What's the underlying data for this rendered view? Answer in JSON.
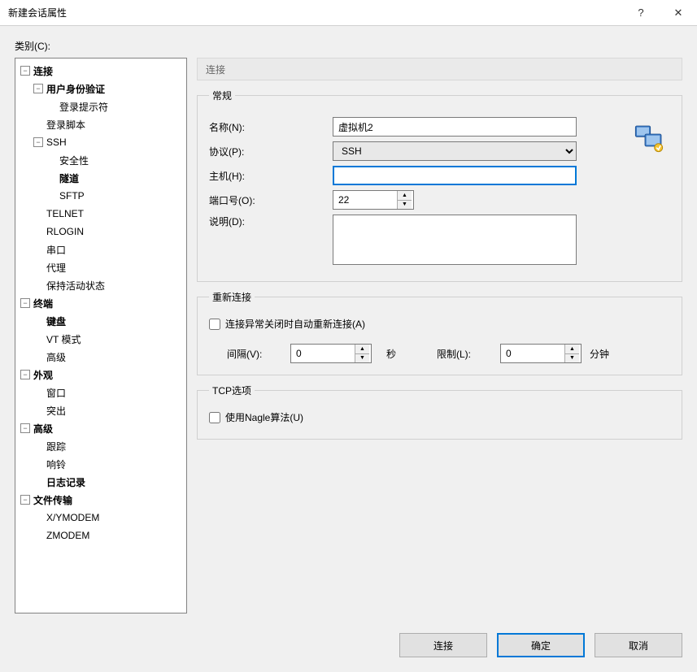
{
  "window": {
    "title": "新建会话属性",
    "help": "?",
    "close": "✕"
  },
  "category_label": "类别(C):",
  "tree": {
    "connection": "连接",
    "user_auth": "用户身份验证",
    "login_prompt": "登录提示符",
    "login_script": "登录脚本",
    "ssh": "SSH",
    "security": "安全性",
    "tunnel": "隧道",
    "sftp": "SFTP",
    "telnet": "TELNET",
    "rlogin": "RLOGIN",
    "serial": "串口",
    "proxy": "代理",
    "keep_alive": "保持活动状态",
    "terminal": "终端",
    "keyboard": "键盘",
    "vt_mode": "VT 模式",
    "advanced_term": "高级",
    "appearance": "外观",
    "window": "窗口",
    "highlight": "突出",
    "advanced": "高级",
    "trace": "跟踪",
    "bell": "响铃",
    "logging": "日志记录",
    "file_transfer": "文件传输",
    "xymodem": "X/YMODEM",
    "zmodem": "ZMODEM"
  },
  "header": "连接",
  "general": {
    "legend": "常规",
    "name_label": "名称(N):",
    "name_value": "虚拟机2",
    "protocol_label": "协议(P):",
    "protocol_value": "SSH",
    "host_label": "主机(H):",
    "host_value": "",
    "port_label": "端口号(O):",
    "port_value": "22",
    "desc_label": "说明(D):",
    "desc_value": ""
  },
  "reconnect": {
    "legend": "重新连接",
    "checkbox_label": "连接异常关闭时自动重新连接(A)",
    "interval_label": "间隔(V):",
    "interval_value": "0",
    "interval_unit": "秒",
    "limit_label": "限制(L):",
    "limit_value": "0",
    "limit_unit": "分钟"
  },
  "tcp": {
    "legend": "TCP选项",
    "nagle_label": "使用Nagle算法(U)"
  },
  "buttons": {
    "connect": "连接",
    "ok": "确定",
    "cancel": "取消"
  }
}
